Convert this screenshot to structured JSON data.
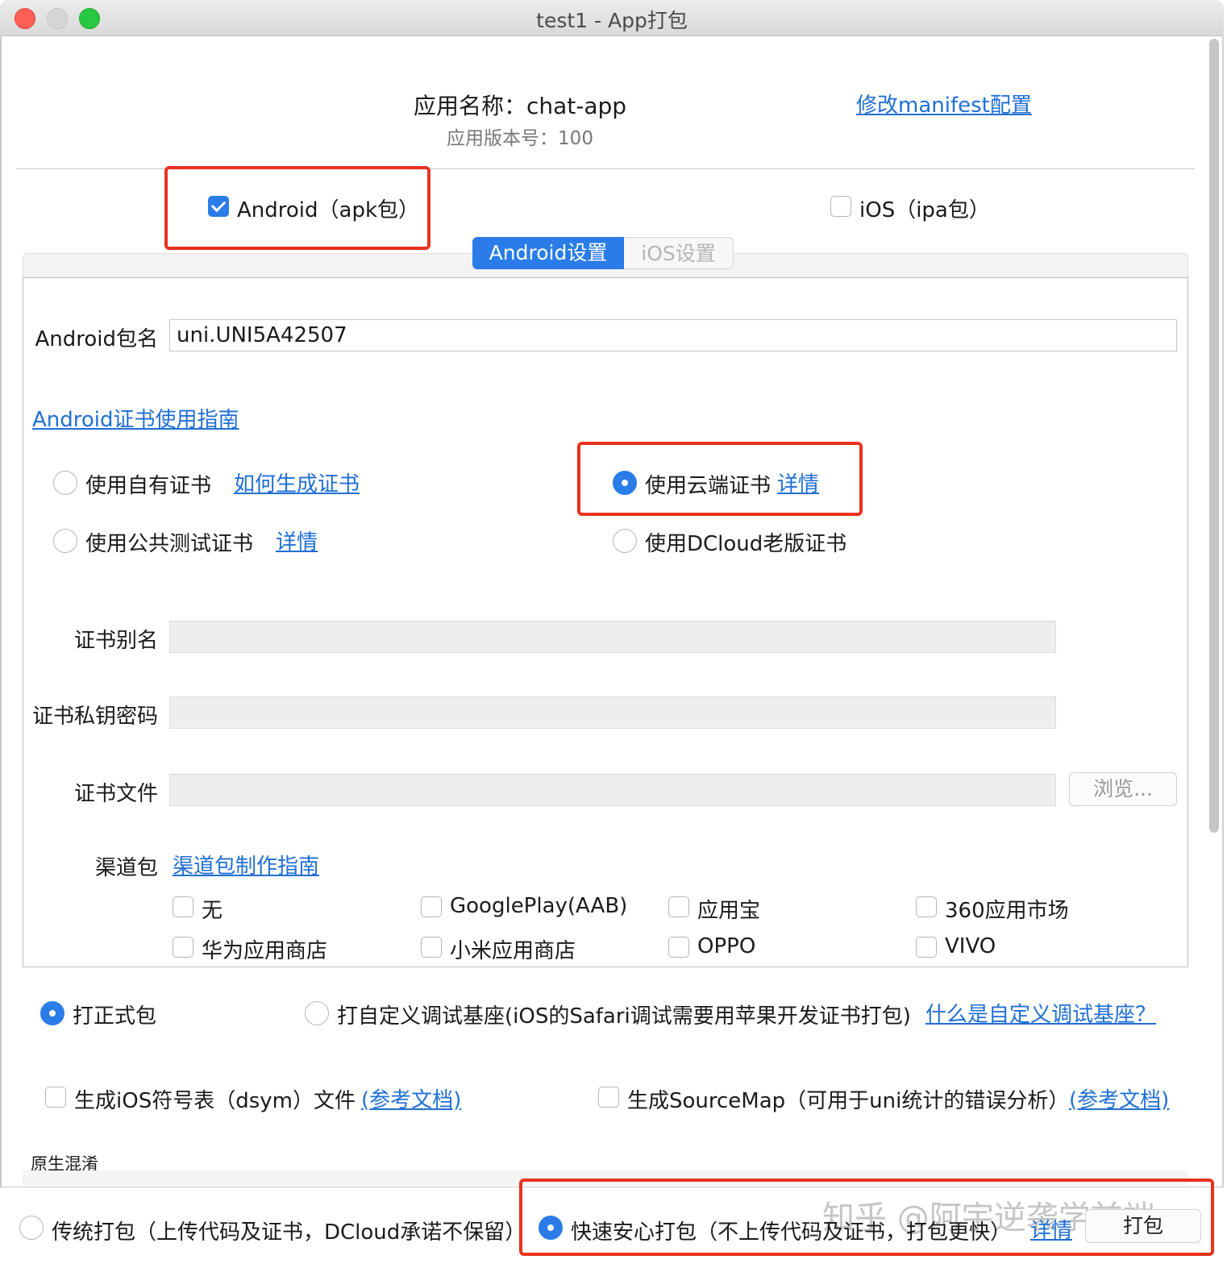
{
  "window": {
    "title": "test1 - App打包"
  },
  "header": {
    "app_name": "应用名称：chat-app",
    "app_version": "应用版本号：100",
    "manifest_link": "修改manifest配置"
  },
  "platforms": {
    "android": {
      "label": "Android（apk包）",
      "checked": true
    },
    "ios": {
      "label": "iOS（ipa包）",
      "checked": false
    }
  },
  "tabs": [
    {
      "label": "Android设置",
      "active": true
    },
    {
      "label": "iOS设置",
      "active": false
    }
  ],
  "android": {
    "package_label": "Android包名",
    "package_value": "uni.UNI5A42507",
    "cert_guide_link": "Android证书使用指南",
    "cert_options": {
      "own": {
        "label": "使用自有证书",
        "link": "如何生成证书",
        "selected": false
      },
      "cloud": {
        "label": "使用云端证书",
        "link": "详情",
        "selected": true
      },
      "public_test": {
        "label": "使用公共测试证书",
        "link": "详情",
        "selected": false
      },
      "dcloud_old": {
        "label": "使用DCloud老版证书",
        "selected": false
      }
    },
    "cert_alias_label": "证书别名",
    "cert_password_label": "证书私钥密码",
    "cert_file_label": "证书文件",
    "browse_button": "浏览...",
    "channel_label": "渠道包",
    "channel_guide_link": "渠道包制作指南",
    "channels": [
      {
        "label": "无",
        "checked": false
      },
      {
        "label": "GooglePlay(AAB)",
        "checked": false
      },
      {
        "label": "应用宝",
        "checked": false
      },
      {
        "label": "360应用市场",
        "checked": false
      },
      {
        "label": "华为应用商店",
        "checked": false
      },
      {
        "label": "小米应用商店",
        "checked": false
      },
      {
        "label": "OPPO",
        "checked": false
      },
      {
        "label": "VIVO",
        "checked": false
      }
    ]
  },
  "build_type": {
    "release": {
      "label": "打正式包",
      "selected": true
    },
    "custom_base": {
      "label": "打自定义调试基座(iOS的Safari调试需要用苹果开发证书打包)",
      "selected": false
    },
    "custom_base_link": "什么是自定义调试基座？"
  },
  "options": {
    "dsym": {
      "label": "生成iOS符号表（dsym）文件",
      "link": "(参考文档)",
      "checked": false
    },
    "sourcemap": {
      "label": "生成SourceMap（可用于uni统计的错误分析）",
      "link": "(参考文档)",
      "checked": false
    }
  },
  "obfuscation_label": "原生混淆",
  "pack_mode": {
    "traditional": {
      "label": "传统打包（上传代码及证书，DCloud承诺不保留）",
      "selected": false
    },
    "fast": {
      "label": "快速安心打包（不上传代码及证书，打包更快）",
      "selected": true
    },
    "fast_link": "详情"
  },
  "pack_button": "打包",
  "watermark": "知乎 @阿宇逆袭学前端",
  "colors": {
    "accent": "#2a7ce8",
    "link": "#1f6fd6",
    "highlight": "#e8321e"
  }
}
